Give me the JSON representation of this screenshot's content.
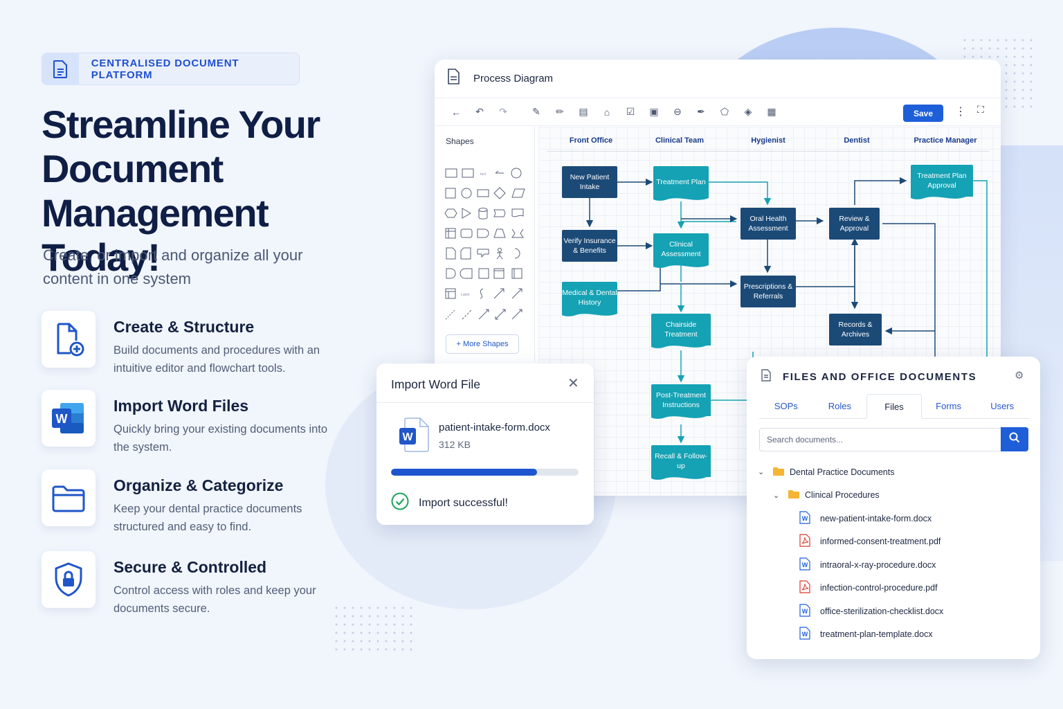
{
  "badge": {
    "text": "CENTRALISED DOCUMENT PLATFORM"
  },
  "hero": {
    "line1": "Streamline Your",
    "line2": "Document Management",
    "line3": "Today!"
  },
  "subtitle": "Create, or import and organize all your content in one system",
  "features": [
    {
      "title": "Create & Structure",
      "desc": "Build documents and procedures with an intuitive editor and flowchart tools."
    },
    {
      "title": "Import Word Files",
      "desc": "Quickly bring your existing documents into the system."
    },
    {
      "title": "Organize & Categorize",
      "desc": "Keep your dental practice documents structured and easy to find."
    },
    {
      "title": "Secure & Controlled",
      "desc": "Control access with roles and keep your documents secure."
    }
  ],
  "diagram": {
    "title": "Process Diagram",
    "save_label": "Save",
    "shapes_title": "Shapes",
    "more_shapes": "+ More Shapes",
    "lanes": [
      "Front Office",
      "Clinical Team",
      "Hygienist",
      "Dentist",
      "Practice Manager"
    ],
    "nodes": {
      "n1": "New Patient Intake",
      "n2": "Verify Insurance & Benefits",
      "n3": "Medical & Dental History",
      "n4": "Treatment Plan",
      "n5": "Clinical Assessment",
      "n6": "Chairside Treatment",
      "n7": "Post-Treatment Instructions",
      "n8": "Recall & Follow-up",
      "n9": "Oral Health Assessment",
      "n10": "Prescriptions & Referrals",
      "n11": "Review & Approval",
      "n12": "Records & Archives",
      "n13": "Treatment Plan Approval"
    }
  },
  "import_dialog": {
    "title": "Import Word File",
    "file_name": "patient-intake-form.docx",
    "file_size": "312 KB",
    "progress": 0.78,
    "status": "Import successful!"
  },
  "files_panel": {
    "title": "FILES AND OFFICE DOCUMENTS",
    "tabs": [
      "SOPs",
      "Roles",
      "Files",
      "Forms",
      "Users"
    ],
    "active_tab": "Files",
    "search_placeholder": "Search documents...",
    "folder": "Dental Practice Documents",
    "subfolder": "Clinical Procedures",
    "files": [
      {
        "name": "new-patient-intake-form.docx",
        "type": "word"
      },
      {
        "name": "informed-consent-treatment.pdf",
        "type": "pdf"
      },
      {
        "name": "intraoral-x-ray-procedure.docx",
        "type": "word"
      },
      {
        "name": "infection-control-procedure.pdf",
        "type": "pdf"
      },
      {
        "name": "office-sterilization-checklist.docx",
        "type": "word"
      },
      {
        "name": "treatment-plan-template.docx",
        "type": "word"
      }
    ]
  },
  "colors": {
    "accent": "#1e5fd9",
    "node_dark": "#1c4a77",
    "node_teal": "#14a2b4",
    "success": "#1fa35a",
    "pdf": "#d9382c"
  }
}
